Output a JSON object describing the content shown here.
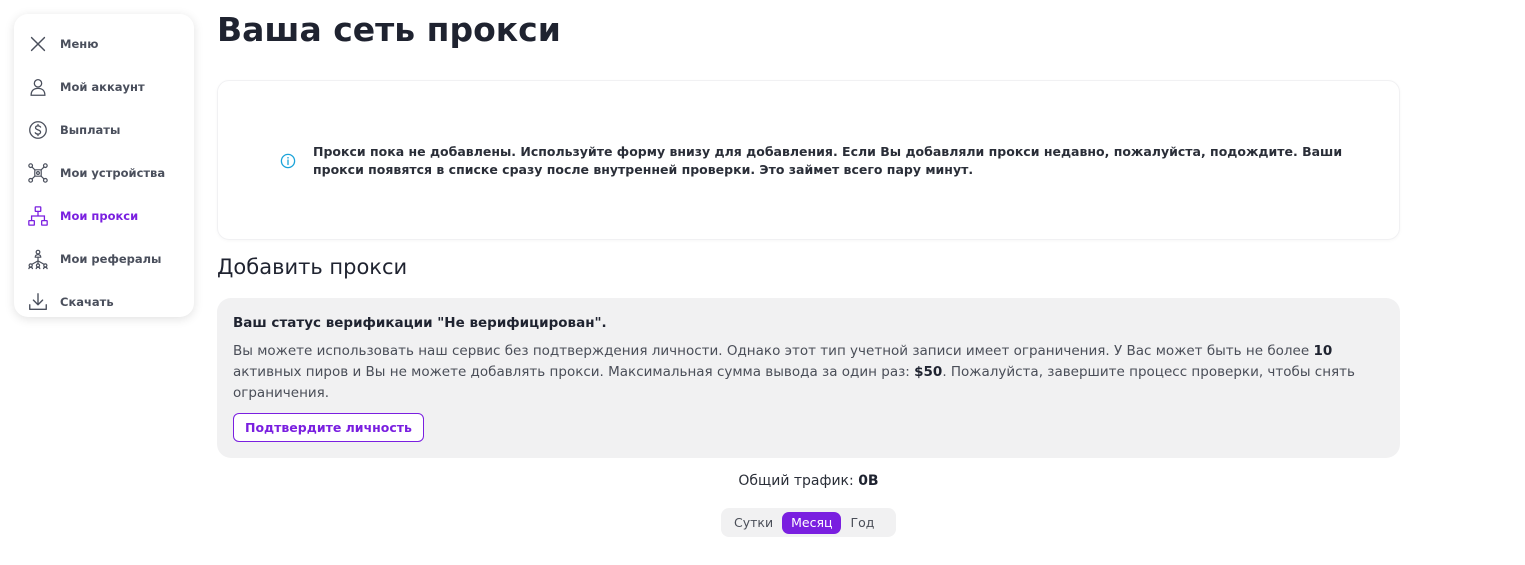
{
  "sidebar": {
    "items": [
      {
        "label": "Меню",
        "icon": "close-icon"
      },
      {
        "label": "Мой аккаунт",
        "icon": "user-icon"
      },
      {
        "label": "Выплаты",
        "icon": "dollar-icon"
      },
      {
        "label": "Мои устройства",
        "icon": "devices-icon"
      },
      {
        "label": "Мои прокси",
        "icon": "network-icon",
        "active": true
      },
      {
        "label": "Мои рефералы",
        "icon": "referrals-icon"
      },
      {
        "label": "Скачать",
        "icon": "download-icon"
      }
    ]
  },
  "main": {
    "title": "Ваша сеть прокси",
    "empty_message": "Прокси пока не добавлены. Используйте форму внизу для добавления. Если Вы добавляли прокси недавно, пожалуйста, подождите. Ваши прокси появятся в списке сразу после внутренней проверки. Это займет всего пару минут.",
    "add_section_title": "Добавить прокси",
    "verification": {
      "title": "Ваш статус верификации \"Не верифицирован\".",
      "text_part1": "Вы можете использовать наш сервис без подтверждения личности. Однако этот тип учетной записи имеет ограничения. У Вас может быть не более ",
      "peer_limit": "10",
      "text_part2": " активных пиров и Вы не можете добавлять прокси. Максимальная сумма вывода за один раз: ",
      "withdraw_limit": "$50",
      "text_part3": ". Пожалуйста, завершите процесс проверки, чтобы снять ограничения.",
      "button_label": "Подтвердите личность"
    },
    "traffic": {
      "label": "Общий трафик: ",
      "value": "0B"
    },
    "periods": [
      {
        "label": "Сутки",
        "active": false
      },
      {
        "label": "Месяц",
        "active": true
      },
      {
        "label": "Год",
        "active": false
      }
    ]
  },
  "colors": {
    "accent": "#7a1fe0",
    "info": "#1aa3d9",
    "card_bg": "#f1f1f2"
  }
}
